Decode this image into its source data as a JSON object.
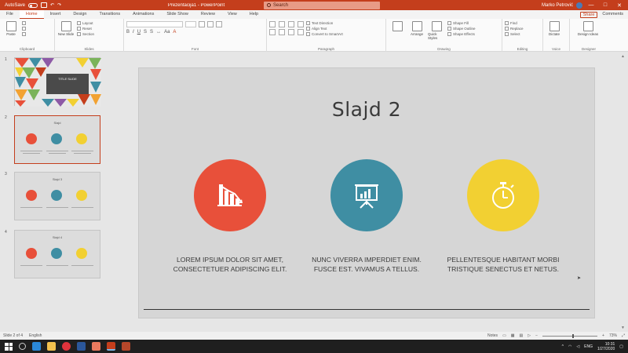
{
  "titlebar": {
    "autosave": "AutoSave",
    "title": "Prezentacija1 - PowerPoint",
    "search_placeholder": "Search",
    "user": "Marko Petrović",
    "minimize": "—",
    "maximize": "□",
    "close": "✕"
  },
  "menu": {
    "tabs": [
      "File",
      "Home",
      "Insert",
      "Design",
      "Transitions",
      "Animations",
      "Slide Show",
      "Review",
      "View",
      "Help"
    ],
    "active_tab": "Home",
    "share": "Share",
    "comments": "Comments"
  },
  "ribbon": {
    "groups": [
      {
        "label": "Clipboard",
        "paste": "Paste"
      },
      {
        "label": "Slides",
        "new_slide": "New Slide",
        "layout": "Layout",
        "reset": "Reset",
        "section": "Section"
      },
      {
        "label": "Font"
      },
      {
        "label": "Paragraph",
        "text_direction": "Text Direction",
        "align_text": "Align Text",
        "smartart": "Convert to SmartArt"
      },
      {
        "label": "Drawing",
        "arrange": "Arrange",
        "quick_styles": "Quick Styles",
        "shape_fill": "Shape Fill",
        "shape_outline": "Shape Outline",
        "shape_effects": "Shape Effects"
      },
      {
        "label": "Editing",
        "find": "Find",
        "replace": "Replace",
        "select": "Select"
      },
      {
        "label": "Voice",
        "dictate": "Dictate"
      },
      {
        "label": "Designer",
        "design_ideas": "Design Ideas"
      }
    ]
  },
  "thumbnails": [
    {
      "num": "1",
      "title": "TITLE SLIDE"
    },
    {
      "num": "2",
      "heading": "Slajd"
    },
    {
      "num": "3",
      "heading": "Slajd 3"
    },
    {
      "num": "4",
      "heading": "Slajd 4"
    }
  ],
  "slide": {
    "title": "Slajd 2",
    "features": [
      {
        "color": "#e8503a",
        "icon": "bar-chart-icon",
        "line1": "LOREM IPSUM DOLOR SIT AMET,",
        "line2": "CONSECTETUER ADIPISCING ELIT."
      },
      {
        "color": "#3f8ea3",
        "icon": "presentation-board-icon",
        "line1": "NUNC VIVERRA IMPERDIET ENIM.",
        "line2": "FUSCE EST. VIVAMUS A TELLUS."
      },
      {
        "color": "#f2d032",
        "icon": "stopwatch-icon",
        "line1": "PELLENTESQUE HABITANT MORBI",
        "line2": "TRISTIQUE SENECTUS ET NETUS."
      }
    ]
  },
  "statusbar": {
    "slide_info": "Slide 2 of 4",
    "language": "English",
    "notes": "Notes",
    "zoom": "73%"
  },
  "taskbar": {
    "time": "10:31",
    "date": "1/27/2020",
    "lang": "ENG"
  }
}
